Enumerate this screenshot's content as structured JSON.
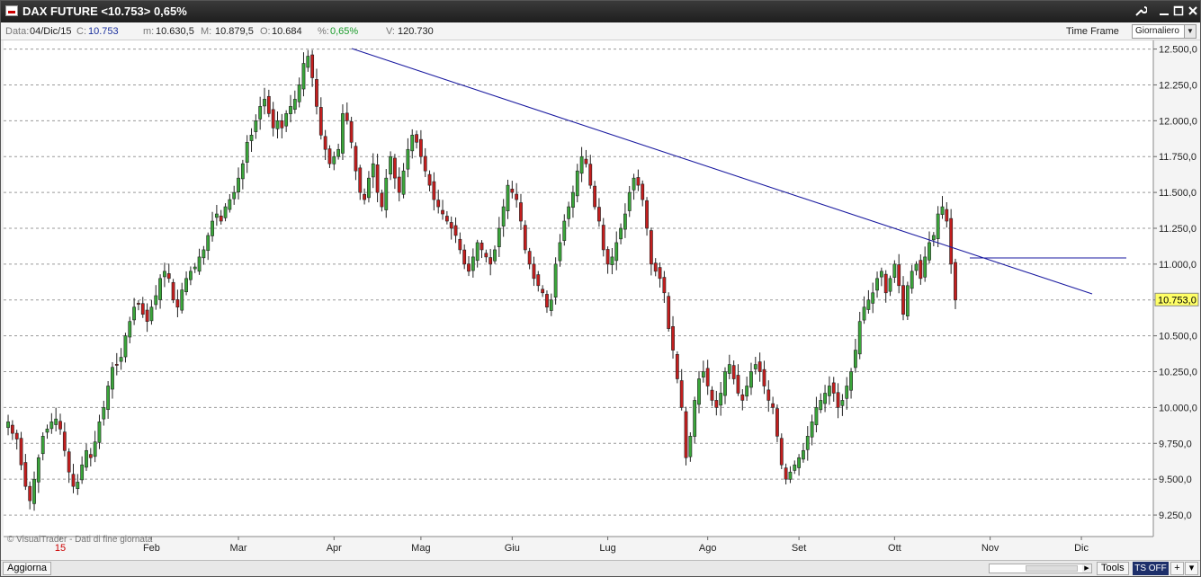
{
  "window": {
    "title": "DAX FUTURE <10.753> 0,65%",
    "icons": [
      "wrench-icon",
      "minimize-icon",
      "maximize-icon",
      "close-icon"
    ]
  },
  "info": {
    "data_label": "Data:",
    "data_value": "04/Dic/15",
    "c_label": "C:",
    "c_value": "10.753",
    "m_label": "m:",
    "m_value": "10.630,5",
    "M_label": "M:",
    "M_value": "10.879,5",
    "o_label": "O:",
    "o_value": "10.684",
    "pct_label": "%:",
    "pct_value": "0,65%",
    "v_label": "V:",
    "v_value": "120.730",
    "timeframe_label": "Time Frame",
    "timeframe_value": "Giornaliero"
  },
  "status": {
    "aggiorna": "Aggiorna",
    "tools": "Tools",
    "tsoff": "TS OFF",
    "plus": "+",
    "chevron": "▾"
  },
  "colors": {
    "up": "#3aa63a",
    "down": "#c41e1e",
    "trendline": "#1a1aa0",
    "price_tag": "#ffff66"
  },
  "chart_data": {
    "type": "candlestick",
    "watermark": "© VisualTrader - Dati di fine giornata",
    "ylim": [
      9100,
      12560
    ],
    "yticks": [
      9250,
      9500,
      9750,
      10000,
      10250,
      10500,
      10750,
      11000,
      11250,
      11500,
      11750,
      12000,
      12250,
      12500
    ],
    "ytick_labels": [
      "9.250,0",
      "9.500,0",
      "9.750,0",
      "10.000,0",
      "10.250,0",
      "10.500,0",
      "10.750,0",
      "11.000,0",
      "11.250,0",
      "11.500,0",
      "11.750,0",
      "12.000,0",
      "12.250,0",
      "12.500,0"
    ],
    "last_price_label": "10.753,0",
    "last_price": 10753,
    "month_labels": [
      {
        "label": "15",
        "index": 0,
        "red": true
      },
      {
        "label": "Feb",
        "index": 21
      },
      {
        "label": "Mar",
        "index": 41
      },
      {
        "label": "Apr",
        "index": 63
      },
      {
        "label": "Mag",
        "index": 83
      },
      {
        "label": "Giu",
        "index": 104
      },
      {
        "label": "Lug",
        "index": 126
      },
      {
        "label": "Ago",
        "index": 149
      },
      {
        "label": "Set",
        "index": 170
      },
      {
        "label": "Ott",
        "index": 192
      },
      {
        "label": "Nov",
        "index": 214
      },
      {
        "label": "Dic",
        "index": 235
      }
    ],
    "first_index": -12,
    "last_index": 238,
    "closes": [
      9900,
      9820,
      9780,
      9600,
      9450,
      9350,
      9500,
      9650,
      9800,
      9850,
      9900,
      9920,
      9850,
      9700,
      9550,
      9450,
      9480,
      9600,
      9700,
      9650,
      9760,
      9900,
      10000,
      10150,
      10280,
      10300,
      10350,
      10500,
      10600,
      10700,
      10720,
      10650,
      10600,
      10700,
      10780,
      10900,
      10950,
      10900,
      10750,
      10700,
      10820,
      10900,
      10950,
      10980,
      11050,
      11100,
      11200,
      11300,
      11350,
      11300,
      11400,
      11450,
      11500,
      11600,
      11700,
      11850,
      11900,
      12000,
      12100,
      12150,
      12050,
      11950,
      12000,
      11950,
      12050,
      12100,
      12150,
      12250,
      12400,
      12450,
      12300,
      12100,
      11900,
      11800,
      11700,
      11750,
      11800,
      12050,
      12000,
      11850,
      11650,
      11500,
      11450,
      11600,
      11700,
      11500,
      11400,
      11600,
      11750,
      11600,
      11500,
      11650,
      11800,
      11900,
      11850,
      11750,
      11650,
      11550,
      11450,
      11400,
      11350,
      11300,
      11250,
      11200,
      11100,
      11000,
      10950,
      11050,
      11150,
      11100,
      11050,
      11000,
      11100,
      11250,
      11400,
      11550,
      11500,
      11450,
      11300,
      11100,
      11000,
      10900,
      10850,
      10800,
      10700,
      10750,
      11000,
      11150,
      11300,
      11400,
      11500,
      11650,
      11750,
      11700,
      11550,
      11400,
      11300,
      11100,
      11000,
      11050,
      11150,
      11250,
      11350,
      11500,
      11600,
      11550,
      11450,
      11250,
      11000,
      10950,
      10900,
      10800,
      10550,
      10400,
      10200,
      10000,
      9650,
      9800,
      10050,
      10200,
      10250,
      10150,
      10050,
      10000,
      10100,
      10250,
      10300,
      10200,
      10100,
      10050,
      10150,
      10250,
      10300,
      10250,
      10150,
      10050,
      10000,
      9800,
      9600,
      9500,
      9550,
      9600,
      9650,
      9700,
      9800,
      9900,
      10000,
      10050,
      10100,
      10150,
      10100,
      10000,
      10050,
      10150,
      10250,
      10400,
      10600,
      10700,
      10750,
      10800,
      10900,
      10950,
      10800,
      10900,
      11000,
      10850,
      10650,
      10850,
      10950,
      11000,
      10900,
      11050,
      11150,
      11200,
      11350,
      11400,
      11300,
      11000,
      10750
    ]
  }
}
